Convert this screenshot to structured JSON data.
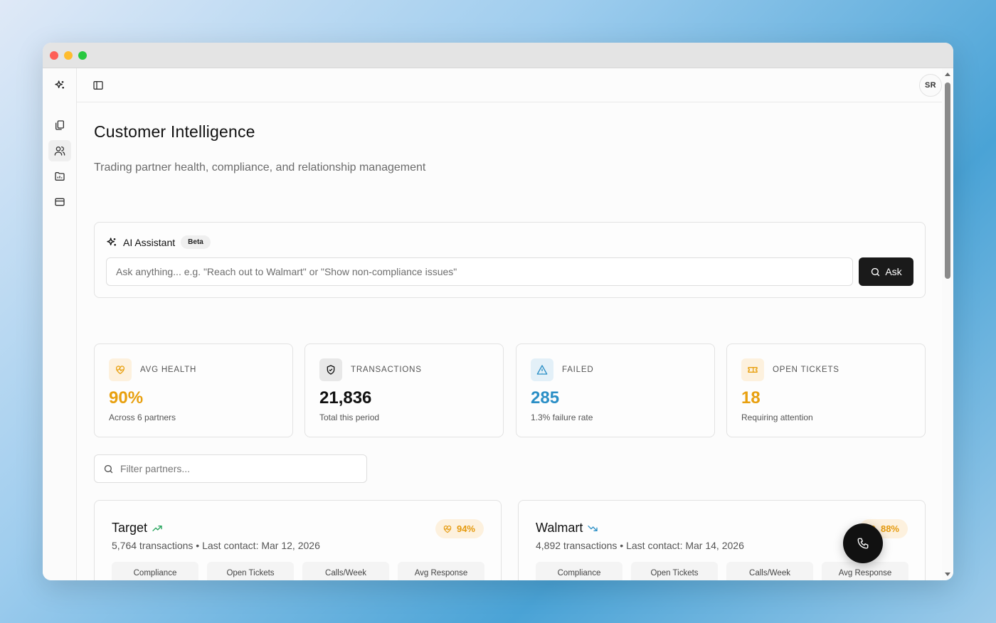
{
  "window": {
    "controls": [
      "close",
      "minimize",
      "maximize"
    ]
  },
  "rail": {
    "items": [
      {
        "name": "sparkles-icon",
        "active": false
      },
      {
        "name": "documents-icon",
        "active": false
      },
      {
        "name": "users-icon",
        "active": true
      },
      {
        "name": "folder-chart-icon",
        "active": false
      },
      {
        "name": "credit-card-icon",
        "active": false
      }
    ]
  },
  "topbar": {
    "avatar_initials": "SR"
  },
  "header": {
    "title": "Customer Intelligence",
    "subtitle": "Trading partner health, compliance, and relationship management"
  },
  "ai_assistant": {
    "title": "AI Assistant",
    "badge": "Beta",
    "placeholder": "Ask anything... e.g. \"Reach out to Walmart\" or \"Show non-compliance issues\"",
    "button_label": "Ask"
  },
  "stats": [
    {
      "label": "AVG HEALTH",
      "value": "90%",
      "note": "Across 6 partners",
      "color": "#e8a00f",
      "icon_bg": "#fdf1de",
      "icon": "heart-pulse-icon"
    },
    {
      "label": "TRANSACTIONS",
      "value": "21,836",
      "note": "Total this period",
      "color": "#111111",
      "icon_bg": "#e8e8e8",
      "icon": "shield-check-icon"
    },
    {
      "label": "FAILED",
      "value": "285",
      "note": "1.3% failure rate",
      "color": "#2b8fc6",
      "icon_bg": "#e3f0f8",
      "icon": "warning-triangle-icon"
    },
    {
      "label": "OPEN TICKETS",
      "value": "18",
      "note": "Requiring attention",
      "color": "#e8a00f",
      "icon_bg": "#fdf1de",
      "icon": "ticket-icon"
    }
  ],
  "filter": {
    "placeholder": "Filter partners..."
  },
  "partners": [
    {
      "name": "Target",
      "trend": "up",
      "trend_color": "#22a35a",
      "meta": "5,764 transactions • Last contact: Mar 12, 2026",
      "health": "94%",
      "metrics": [
        "Compliance",
        "Open Tickets",
        "Calls/Week",
        "Avg Response"
      ]
    },
    {
      "name": "Walmart",
      "trend": "down",
      "trend_color": "#2b8fc6",
      "meta": "4,892 transactions • Last contact: Mar 14, 2026",
      "health": "88%",
      "metrics": [
        "Compliance",
        "Open Tickets",
        "Calls/Week",
        "Avg Response"
      ]
    }
  ],
  "fab": {
    "icon": "phone-icon"
  }
}
